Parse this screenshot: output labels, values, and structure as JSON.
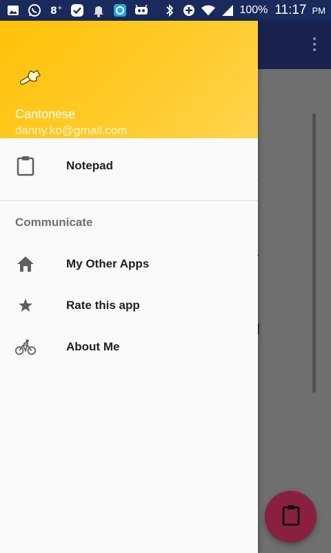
{
  "status_bar": {
    "battery": "100%",
    "time": "11:17",
    "ampm": "PM",
    "icons": [
      "gallery-icon",
      "whatsapp-icon",
      "google-plus-icon",
      "check-icon",
      "notification-bell-icon",
      "browser-icon",
      "android-icon",
      "bluetooth-icon",
      "data-saver-icon",
      "wifi-icon",
      "signal-icon",
      "battery-icon"
    ]
  },
  "drawer": {
    "header": {
      "name": "Cantonese",
      "email": "danny.ko@gmail.com",
      "icon": "wrench-icon",
      "color": "#FFC107"
    },
    "items": [
      {
        "label": "Notepad",
        "icon": "clipboard-icon"
      }
    ],
    "section": {
      "title": "Communicate",
      "items": [
        {
          "label": "My Other Apps",
          "icon": "home-icon"
        },
        {
          "label": "Rate this app",
          "icon": "star-icon"
        },
        {
          "label": "About Me",
          "icon": "bicycle-icon"
        }
      ]
    }
  },
  "background": {
    "fragments": [
      "es",
      "s",
      "g"
    ],
    "fab_icon": "clipboard-icon",
    "fab_color": "#8A2040"
  }
}
